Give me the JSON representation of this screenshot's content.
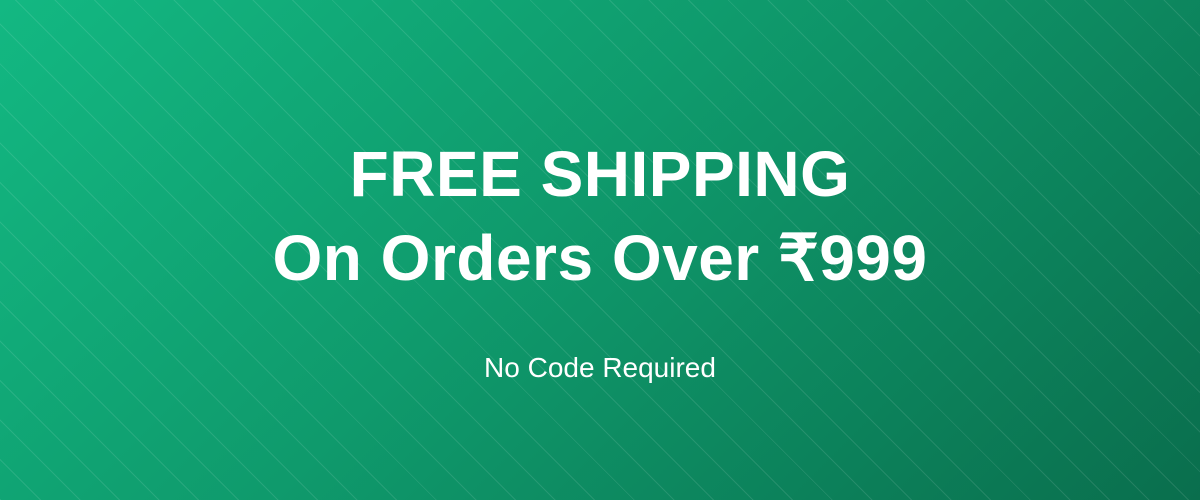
{
  "banner": {
    "headline_line1": "FREE SHIPPING",
    "headline_line2": "On Orders Over ₹999",
    "subtext": "No Code Required",
    "colors": {
      "gradient_start": "#13b882",
      "gradient_end": "#0a6e4d",
      "text": "#ffffff"
    }
  }
}
